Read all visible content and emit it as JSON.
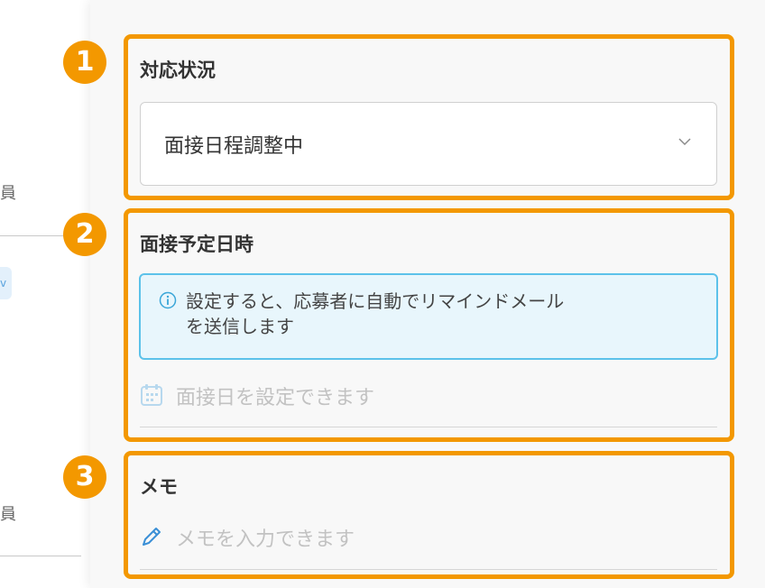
{
  "left_panel": {
    "label_1": "員",
    "label_2": "員",
    "chip": "v"
  },
  "sections": {
    "status": {
      "badge": "1",
      "title": "対応状況",
      "selected": "面接日程調整中"
    },
    "interview": {
      "badge": "2",
      "title": "面接予定日時",
      "info_line_1": "設定すると、応募者に自動でリマインドメール",
      "info_line_2": "を送信します",
      "date_placeholder": "面接日を設定できます"
    },
    "memo": {
      "badge": "3",
      "title": "メモ",
      "memo_placeholder": "メモを入力できます"
    }
  },
  "colors": {
    "highlight": "#f39800",
    "info_border": "#5cc2ea",
    "info_bg": "#e8f6fc",
    "memo_icon": "#3a8fd6"
  },
  "icons": {
    "select": "chevron-down-icon",
    "info": "info-icon",
    "date": "calendar-icon",
    "memo": "pencil-icon"
  }
}
